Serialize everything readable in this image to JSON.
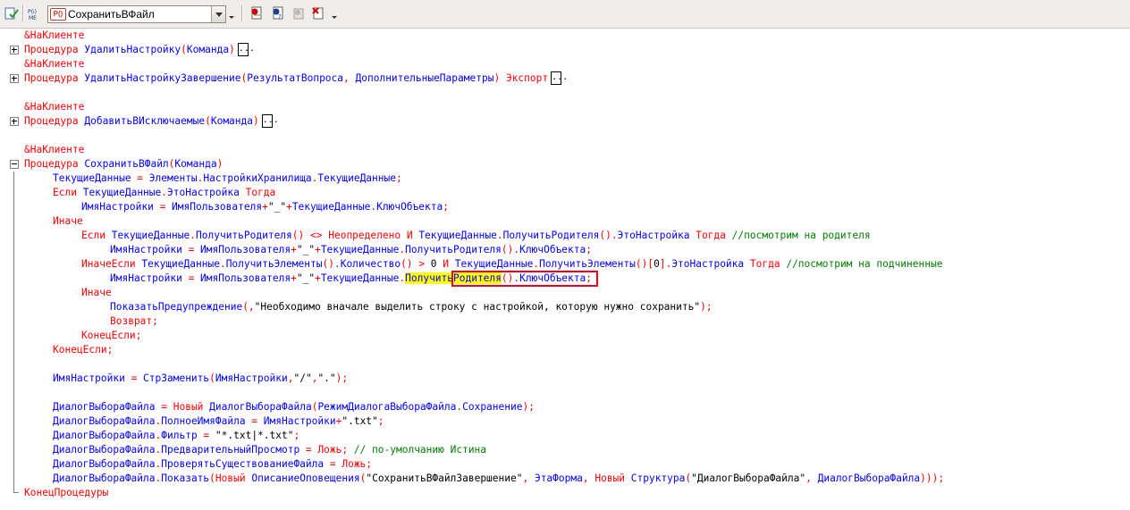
{
  "toolbar": {
    "procedure_badge": "P()",
    "procedure_name": "СохранитьВФайл",
    "icons": [
      "check-module-icon",
      "syntax-check-icon",
      "procedure-select-icon",
      "insert-breakpoint-icon",
      "toggle-breakpoint-icon",
      "disable-breakpoint-icon",
      "delete-breakpoint-icon"
    ]
  },
  "colors": {
    "keyword": "#ff0000",
    "identifier": "#0000ff",
    "text": "#000000",
    "comment": "#008000",
    "highlight": "#ffff00",
    "marker": "#e8001c"
  },
  "code": {
    "l1": {
      "a": "&НаКлиенте"
    },
    "l2": {
      "a": "Процедура",
      "b": "УдалитьНастройку",
      "c": "(",
      "d": "Команда",
      "e": ")",
      "f": "..."
    },
    "l3": {
      "a": "&НаКлиенте"
    },
    "l4": {
      "a": "Процедура",
      "b": "УдалитьНастройкуЗавершение",
      "c": "(",
      "d": "РезультатВопроса",
      "e": ", ",
      "f": "ДополнительныеПараметры",
      "g": ")",
      "h": "Экспорт",
      "i": "..."
    },
    "l6": {
      "a": "&НаКлиенте"
    },
    "l7": {
      "a": "Процедура",
      "b": "ДобавитьВИсключаемые",
      "c": "(",
      "d": "Команда",
      "e": ")",
      "f": "..."
    },
    "l9": {
      "a": "&НаКлиенте"
    },
    "l10": {
      "a": "Процедура",
      "b": "СохранитьВФайл",
      "c": "(",
      "d": "Команда",
      "e": ")"
    },
    "l11": {
      "a": "ТекущиеДанные",
      "b": " = ",
      "c": "Элементы",
      "d": ".",
      "e": "НастройкиХранилища",
      "f": ".",
      "g": "ТекущиеДанные",
      "h": ";"
    },
    "l12": {
      "a": "Если",
      "b": "ТекущиеДанные",
      "c": ".",
      "d": "ЭтоНастройка",
      "e": "Тогда"
    },
    "l13": {
      "a": "ИмяНастройки",
      "b": " = ",
      "c": "ИмяПользователя",
      "d": "+",
      "e": "\"_\"",
      "f": "+",
      "g": "ТекущиеДанные",
      "h": ".",
      "i": "КлючОбъекта",
      "j": ";"
    },
    "l14": {
      "a": "Иначе"
    },
    "l15": {
      "a": "Если",
      "b": "ТекущиеДанные",
      "c": ".",
      "d": "ПолучитьРодителя",
      "e": "()",
      "f": " <> ",
      "g": "Неопределено",
      "h": "И",
      "i": "ТекущиеДанные",
      "j": ".",
      "k": "ПолучитьРодителя",
      "l": "()",
      "m": ".",
      "n": "ЭтоНастройка",
      "o": "Тогда",
      "p": "//посмотрим на родителя"
    },
    "l16": {
      "a": "ИмяНастройки",
      "b": " = ",
      "c": "ИмяПользователя",
      "d": "+",
      "e": "\"_\"",
      "f": "+",
      "g": "ТекущиеДанные",
      "h": ".",
      "i": "ПолучитьРодителя",
      "j": "()",
      "k": ".",
      "l": "КлючОбъекта",
      "m": ";"
    },
    "l17": {
      "a": "ИначеЕсли",
      "b": "ТекущиеДанные",
      "c": ".",
      "d": "ПолучитьЭлементы",
      "e": "()",
      "f": ".",
      "g": "Количество",
      "h": "()",
      "i": " > ",
      "j": "0",
      "k": "И",
      "l": "ТекущиеДанные",
      "m": ".",
      "n": "ПолучитьЭлементы",
      "o": "()[",
      "p": "0",
      "q": "].",
      "r": "ЭтоНастройка",
      "s": "Тогда",
      "t": "//посмотрим на подчиненные"
    },
    "l18": {
      "a": "ИмяНастройки",
      "b": " = ",
      "c": "ИмяПользователя",
      "d": "+",
      "e": "\"_\"",
      "f": "+",
      "g": "ТекущиеДанные",
      "h": ".",
      "i": "ПолучитьРодителя",
      "j": "()",
      "k": ".",
      "l": "КлючОбъекта",
      "m": ";"
    },
    "l19": {
      "a": "Иначе"
    },
    "l20": {
      "a": "ПоказатьПредупреждение",
      "b": "(,",
      "c": "\"Необходимо вначале выделить строку с настройкой, которую нужно сохранить\"",
      "d": ");"
    },
    "l21": {
      "a": "Возврат;"
    },
    "l22": {
      "a": "КонецЕсли;"
    },
    "l23": {
      "a": "КонецЕсли;"
    },
    "l25": {
      "a": "ИмяНастройки",
      "b": " = ",
      "c": "СтрЗаменить",
      "d": "(",
      "e": "ИмяНастройки",
      "f": ",",
      "g": "\"/\"",
      "h": ",",
      "i": "\".\"",
      "j": ");"
    },
    "l27": {
      "a": "ДиалогВыбораФайла",
      "b": " = ",
      "c": "Новый",
      "d": "ДиалогВыбораФайла",
      "e": "(",
      "f": "РежимДиалогаВыбораФайла",
      "g": ".",
      "h": "Сохранение",
      "i": ");"
    },
    "l28": {
      "a": "ДиалогВыбораФайла",
      "b": ".",
      "c": "ПолноеИмяФайла",
      "d": " = ",
      "e": "ИмяНастройки",
      "f": "+",
      "g": "\".txt\"",
      "h": ";"
    },
    "l29": {
      "a": "ДиалогВыбораФайла",
      "b": ".",
      "c": "Фильтр",
      "d": " = ",
      "e": "\"*.txt|*.txt\"",
      "f": ";"
    },
    "l30": {
      "a": "ДиалогВыбораФайла",
      "b": ".",
      "c": "ПредварительныйПросмотр",
      "d": " = ",
      "e": "Ложь",
      "f": ";",
      "g": " // по-умолчанию Истина"
    },
    "l31": {
      "a": "ДиалогВыбораФайла",
      "b": ".",
      "c": "ПроверятьСуществованиеФайла",
      "d": " = ",
      "e": "Ложь",
      "f": ";"
    },
    "l32": {
      "a": "ДиалогВыбораФайла",
      "b": ".",
      "c": "Показать",
      "d": "(",
      "e": "Новый",
      "f": "ОписаниеОповещения",
      "g": "(",
      "h": "\"СохранитьВФайлЗавершение\"",
      "i": ", ",
      "j": "ЭтаФорма",
      "k": ", ",
      "l": "Новый",
      "m": "Структура",
      "n": "(",
      "o": "\"ДиалогВыбораФайла\"",
      "p": ", ",
      "q": "ДиалогВыбораФайла",
      "r": ")));"
    },
    "l33": {
      "a": "КонецПроцедуры"
    }
  }
}
